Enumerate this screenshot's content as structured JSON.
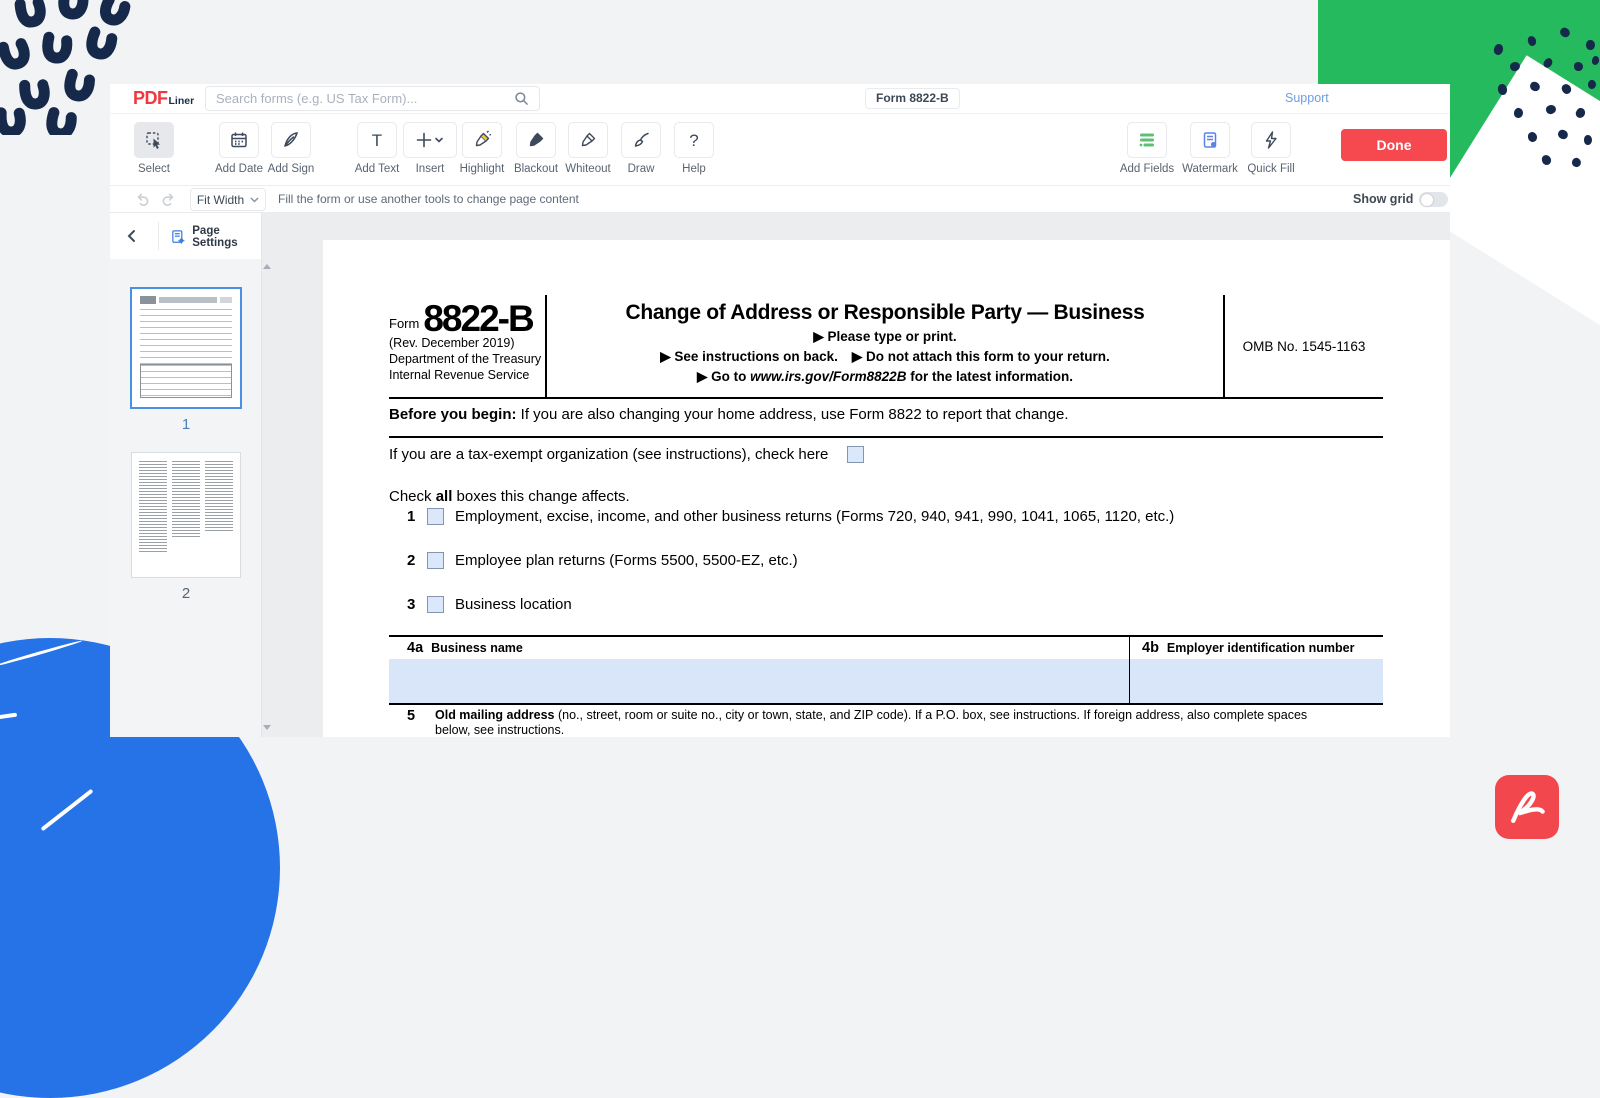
{
  "header": {
    "logo_pdf": "PDF",
    "logo_liner": "Liner",
    "search_placeholder": "Search forms (e.g. US Tax Form)...",
    "form_badge": "Form 8822-B",
    "support": "Support"
  },
  "toolbar": {
    "select": "Select",
    "add_date": "Add Date",
    "add_sign": "Add Sign",
    "add_text": "Add Text",
    "insert": "Insert",
    "highlight": "Highlight",
    "blackout": "Blackout",
    "whiteout": "Whiteout",
    "draw": "Draw",
    "help": "Help",
    "add_fields": "Add Fields",
    "watermark": "Watermark",
    "quick_fill": "Quick Fill",
    "done": "Done"
  },
  "icons": {
    "add_text_glyph": "T",
    "help_glyph": "?"
  },
  "view_bar": {
    "zoom_mode": "Fit Width",
    "hint": "Fill the form or use another tools to change page content",
    "show_grid_label": "Show grid",
    "grid_on": false
  },
  "sidebar": {
    "page_settings_label": "Page Settings",
    "pages": [
      {
        "label": "1",
        "selected": true
      },
      {
        "label": "2",
        "selected": false
      }
    ]
  },
  "form": {
    "form_word": "Form",
    "form_number": "8822-B",
    "revision": "(Rev. December 2019)",
    "dept1": "Department of the Treasury",
    "dept2": "Internal Revenue Service",
    "title": "Change of Address or Responsible Party — Business",
    "subtitle1": "▶ Please type or print.",
    "subtitle2a": "▶ See instructions on back.",
    "subtitle2b": "▶ Do not attach this form to your return.",
    "subtitle3_prefix": "▶ Go to ",
    "subtitle3_url": "www.irs.gov/Form8822B",
    "subtitle3_suffix": " for the latest information.",
    "omb": "OMB No. 1545-1163",
    "before_begin_bold": "Before you begin:",
    "before_begin_rest": " If you are also changing your home address, use Form 8822 to report that change.",
    "tax_exempt_text": "If you are a tax-exempt organization (see instructions), check here",
    "check_all_pre": "Check ",
    "check_all_bold": "all",
    "check_all_post": " boxes this change affects.",
    "items": [
      {
        "num": "1",
        "text": "Employment, excise, income, and other business returns (Forms 720, 940, 941, 990, 1041, 1065, 1120, etc.)"
      },
      {
        "num": "2",
        "text": "Employee plan returns (Forms 5500, 5500-EZ, etc.)"
      },
      {
        "num": "3",
        "text": "Business location"
      }
    ],
    "f4a_num": "4a",
    "f4a_label": "Business name",
    "f4b_num": "4b",
    "f4b_label": "Employer identification number",
    "i5_num": "5",
    "i5_bold": "Old mailing address",
    "i5_rest": " (no., street, room or suite no., city or town, state, and ZIP code). If a P.O. box, see instructions. If foreign address, also complete spaces below, see instructions."
  },
  "colors": {
    "accent_red": "#f6494f",
    "brand_red": "#f0383e",
    "deco_green": "#25ba5e",
    "deco_navy": "#16294a",
    "deco_blue": "#2673e8",
    "link_blue": "#6f9ddd",
    "field_blue": "#d9e6f9",
    "selected_thumb_border": "#4a90e2"
  }
}
